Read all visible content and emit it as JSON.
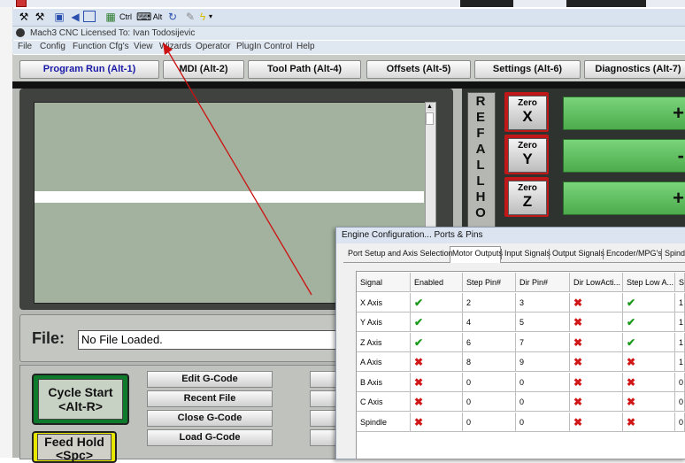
{
  "toolbar": {
    "icons": [
      "tool-icon",
      "tool2-icon",
      "window-icon",
      "speaker-icon",
      "monitor-icon",
      "grid-icon",
      "ctrl-key-icon",
      "keyboard-icon",
      "alt-key-icon",
      "refresh-icon",
      "pen-icon",
      "bolt-icon",
      "dropdown-icon"
    ],
    "ctrl_label": "Ctrl",
    "alt_label": "Alt"
  },
  "window": {
    "title": "Mach3 CNC  Licensed To: Ivan Todosijevic"
  },
  "menu": [
    "File",
    "Config",
    "Function Cfg's",
    "View",
    "Wizards",
    "Operator",
    "PlugIn Control",
    "Help"
  ],
  "tabs": [
    {
      "label": "Program Run (Alt-1)",
      "active": true
    },
    {
      "label": "MDI (Alt-2)",
      "active": false
    },
    {
      "label": "Tool Path (Alt-4)",
      "active": false
    },
    {
      "label": "Offsets (Alt-5)",
      "active": false
    },
    {
      "label": "Settings (Alt-6)",
      "active": false
    },
    {
      "label": "Diagnostics (Alt-7)",
      "active": false
    }
  ],
  "file": {
    "label": "File:",
    "value": "No File Loaded."
  },
  "cycle_start": {
    "line1": "Cycle Start",
    "line2": "<Alt-R>"
  },
  "feed_hold": {
    "line1": "Feed Hold",
    "line2": "<Spc>"
  },
  "gcode_buttons": [
    "Edit G-Code",
    "Recent File",
    "Close G-Code",
    "Load G-Code"
  ],
  "ref_all_home": [
    "R",
    "E",
    "F",
    "A",
    "L",
    "L",
    "H",
    "O"
  ],
  "zero_buttons": [
    {
      "label": "Zero",
      "axis": "X"
    },
    {
      "label": "Zero",
      "axis": "Y"
    },
    {
      "label": "Zero",
      "axis": "Z"
    }
  ],
  "dro_signs": [
    "+",
    "-",
    "+"
  ],
  "dialog": {
    "title": "Engine Configuration... Ports & Pins",
    "tabs": [
      "Port Setup and Axis Selection",
      "Motor Outputs",
      "Input Signals",
      "Output Signals",
      "Encoder/MPG's",
      "Spindle"
    ],
    "active_tab": "Motor Outputs",
    "columns": [
      "Signal",
      "Enabled",
      "Step Pin#",
      "Dir Pin#",
      "Dir LowActi...",
      "Step Low A...",
      "St"
    ],
    "rows": [
      {
        "signal": "X Axis",
        "enabled": true,
        "step_pin": "2",
        "dir_pin": "3",
        "dir_low": false,
        "step_low": true,
        "st": "1"
      },
      {
        "signal": "Y Axis",
        "enabled": true,
        "step_pin": "4",
        "dir_pin": "5",
        "dir_low": false,
        "step_low": true,
        "st": "1"
      },
      {
        "signal": "Z Axis",
        "enabled": true,
        "step_pin": "6",
        "dir_pin": "7",
        "dir_low": false,
        "step_low": true,
        "st": "1"
      },
      {
        "signal": "A Axis",
        "enabled": false,
        "step_pin": "8",
        "dir_pin": "9",
        "dir_low": false,
        "step_low": false,
        "st": "1"
      },
      {
        "signal": "B Axis",
        "enabled": false,
        "step_pin": "0",
        "dir_pin": "0",
        "dir_low": false,
        "step_low": false,
        "st": "0"
      },
      {
        "signal": "C Axis",
        "enabled": false,
        "step_pin": "0",
        "dir_pin": "0",
        "dir_low": false,
        "step_low": false,
        "st": "0"
      },
      {
        "signal": "Spindle",
        "enabled": false,
        "step_pin": "0",
        "dir_pin": "0",
        "dir_low": false,
        "step_low": false,
        "st": "0"
      }
    ]
  },
  "colors": {
    "annotation_arrow": "#cc1111",
    "check": "#1a9a1a",
    "cross": "#d01818",
    "dro_green": "#5cbf5c",
    "zero_red": "#c01818"
  }
}
